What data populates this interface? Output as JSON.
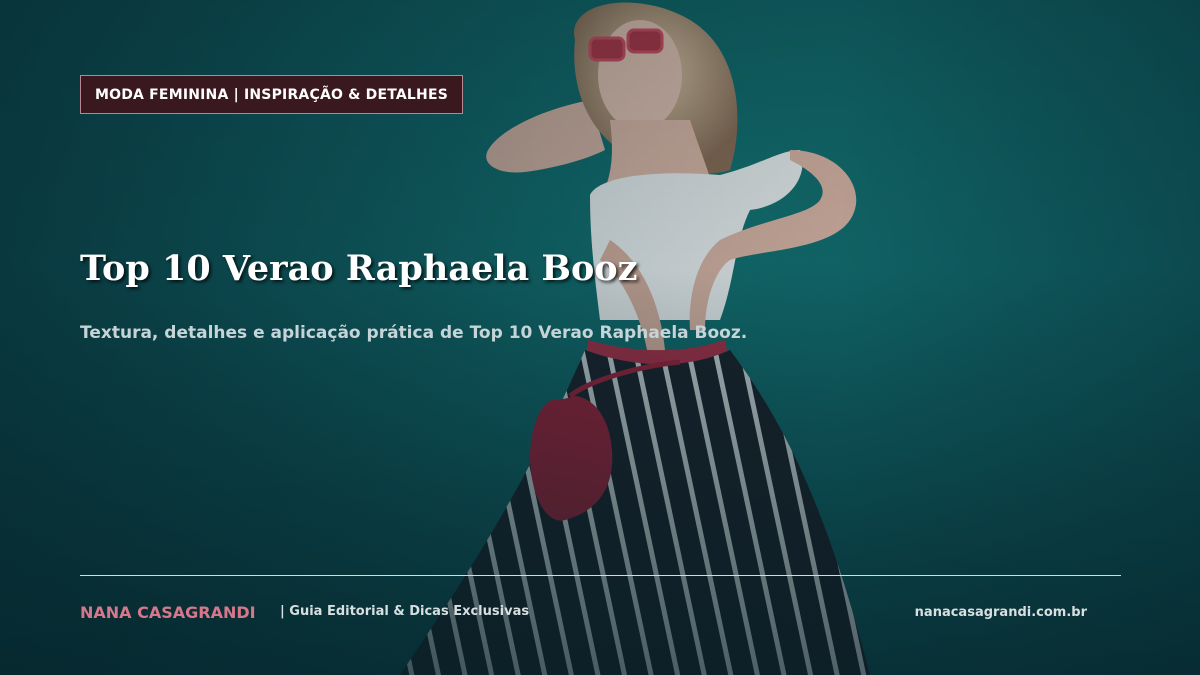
{
  "hero": {
    "photo_subject": "woman in white top, striped trousers and red bag against a teal wall"
  },
  "badge": {
    "label": "MODA FEMININA | INSPIRAÇÃO & DETALHES"
  },
  "headline": {
    "title": "Top 10 Verao Raphaela Booz",
    "subtitle": "Textura, detalhes e aplicação prática de Top 10 Verao Raphaela Booz."
  },
  "footer": {
    "brand": "NANA CASAGRANDI",
    "tagline": "| Guia Editorial & Dicas Exclusivas",
    "website": "nanacasagrandi.com.br"
  },
  "colors": {
    "background": "#0f5e63",
    "badge_bg": "#3a1820",
    "brand_accent": "#d6788c"
  }
}
